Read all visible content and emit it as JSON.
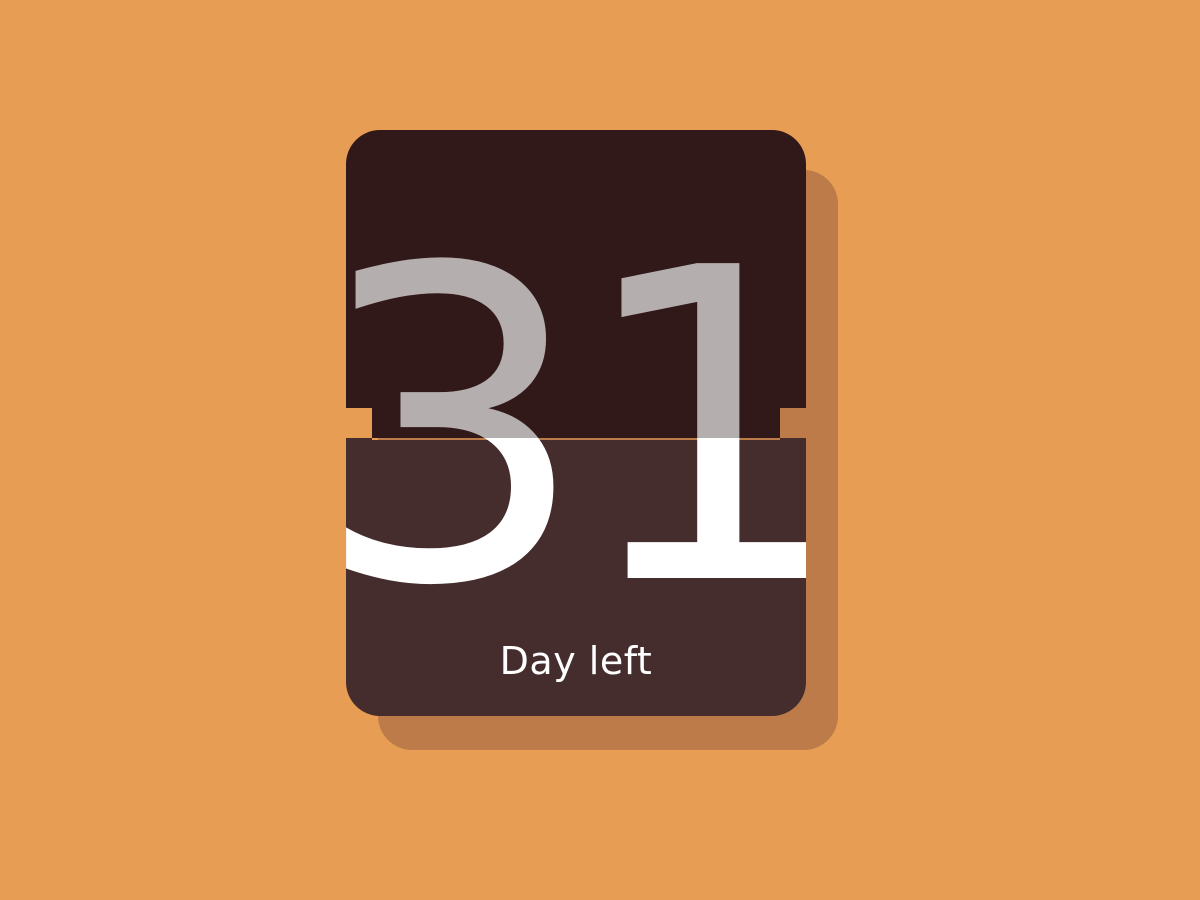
{
  "counter": {
    "value": "31",
    "caption": "Day left"
  },
  "colors": {
    "background": "#E89D55",
    "shadow": "#BC7B49",
    "card_top": "#301918",
    "card_bottom": "#452C2D",
    "digit_top": "#B5AEAE",
    "digit_bottom": "#FFFFFF",
    "caption": "#FFFFFF"
  },
  "icons": {
    "flip_card": "flip-clock-card"
  }
}
